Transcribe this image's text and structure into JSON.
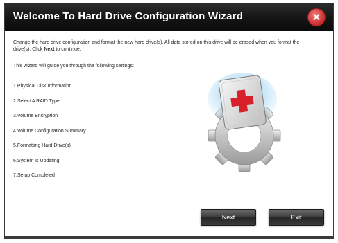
{
  "dialog": {
    "title": "Welcome To Hard Drive Configuration Wizard",
    "intro_before_bold": "Change the hard drive configuration and format the new hard drive(s). All data stored on this drive will be erased when you format the drive(s). Click ",
    "intro_bold": "Next",
    "intro_after_bold": " to continue.",
    "guide_text": "This wizard will guide you through the following settings:",
    "steps": [
      "1.Physical Disk Information",
      "2.Select A RAID Type",
      "3.Volume Encryption",
      "4.Volume Configuration Summary",
      "5.Formatting Hard Drive(s)",
      "6.System Is Updating",
      "7.Setup Completed"
    ],
    "buttons": {
      "next_label": "Next",
      "exit_label": "Exit"
    },
    "close_glyph": "✕"
  },
  "icons": {
    "close": "close-icon",
    "illustration": "hard-drive-gear-icon"
  },
  "colors": {
    "titlebar": "#141414",
    "close_button": "#c92c2c",
    "accent_cross": "#d8202a",
    "button": "#3a3a3a"
  }
}
